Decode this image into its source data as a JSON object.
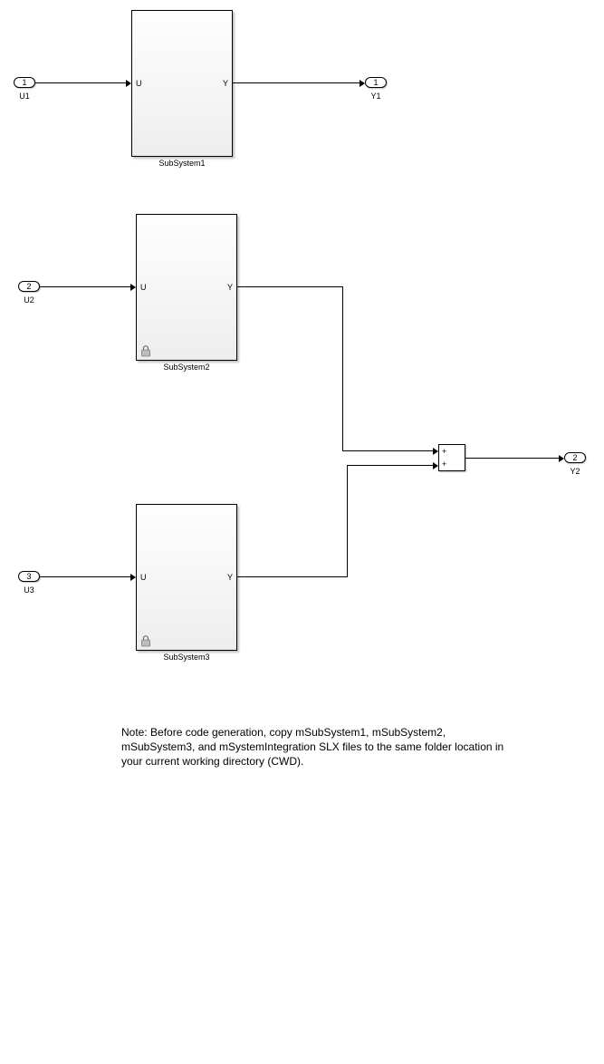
{
  "ports": {
    "in1": {
      "num": "1",
      "label": "U1"
    },
    "in2": {
      "num": "2",
      "label": "U2"
    },
    "in3": {
      "num": "3",
      "label": "U3"
    },
    "out1": {
      "num": "1",
      "label": "Y1"
    },
    "out2": {
      "num": "2",
      "label": "Y2"
    }
  },
  "blocks": {
    "sub1": {
      "name": "SubSystem1",
      "inlabel": "U",
      "outlabel": "Y"
    },
    "sub2": {
      "name": "SubSystem2",
      "inlabel": "U",
      "outlabel": "Y"
    },
    "sub3": {
      "name": "SubSystem3",
      "inlabel": "U",
      "outlabel": "Y"
    }
  },
  "sum": {
    "p1": "+",
    "p2": "+"
  },
  "note": "Note: Before code generation, copy mSubSystem1, mSubSystem2, mSubSystem3, and mSystemIntegration SLX files to the same folder location in your current working directory (CWD)."
}
